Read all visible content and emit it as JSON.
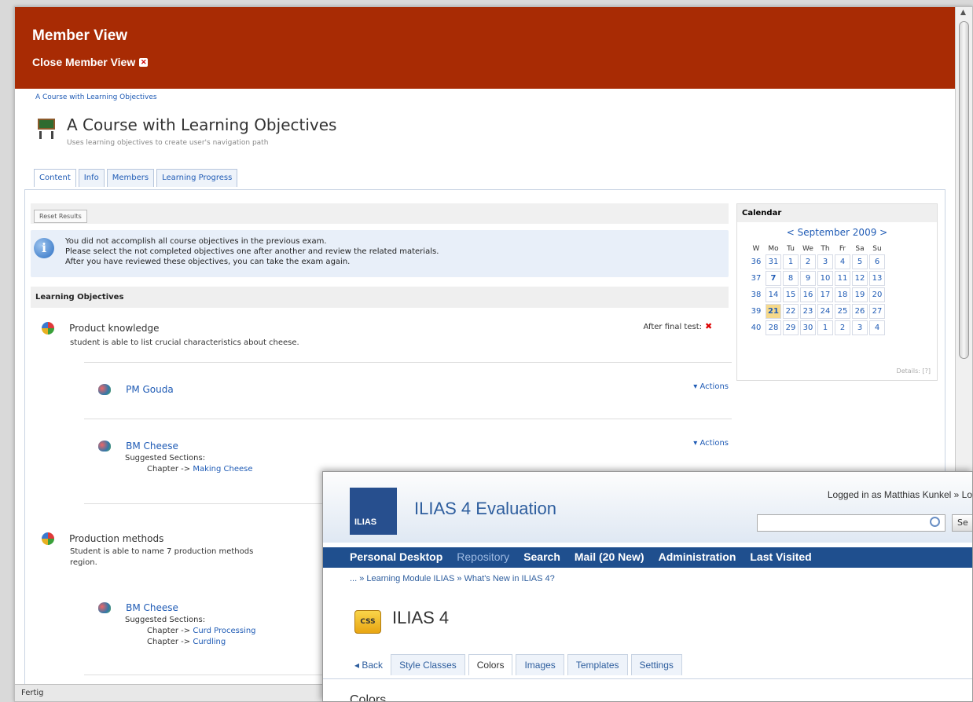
{
  "member_view": {
    "title": "Member View",
    "close_label": "Close Member View"
  },
  "breadcrumb": "A Course with Learning Objectives",
  "course": {
    "title": "A Course with Learning Objectives",
    "description": "Uses learning objectives to create user's navigation path"
  },
  "tabs": [
    "Content",
    "Info",
    "Members",
    "Learning Progress"
  ],
  "reset_button": "Reset Results",
  "info_message": [
    "You did not accomplish all course objectives in the previous exam.",
    "Please select the not completed objectives one after another and review the related materials.",
    "After you have reviewed these objectives, you can take the exam again."
  ],
  "objectives_header": "Learning Objectives",
  "objectives": [
    {
      "title": "Product knowledge",
      "description": "student is able to list crucial characteristics about cheese.",
      "after_test": "After final test:",
      "items": [
        {
          "title": "PM Gouda",
          "actions": "Actions"
        },
        {
          "title": "BM Cheese",
          "actions": "Actions",
          "suggested": "Suggested Sections:",
          "chapter_prefix": "Chapter ->",
          "chapters": [
            "Making Cheese"
          ]
        }
      ]
    },
    {
      "title": "Production methods",
      "description": "Student is able to name 7 production methods",
      "description2": "region.",
      "items": [
        {
          "title": "BM Cheese",
          "suggested": "Suggested Sections:",
          "chapter_prefix": "Chapter ->",
          "chapters": [
            "Curd Processing",
            "Curdling"
          ]
        }
      ]
    }
  ],
  "calendar": {
    "header": "Calendar",
    "month": "< September 2009 >",
    "weekday_header": [
      "W",
      "Mo",
      "Tu",
      "We",
      "Th",
      "Fr",
      "Sa",
      "Su"
    ],
    "weeks": [
      [
        "36",
        "31",
        "1",
        "2",
        "3",
        "4",
        "5",
        "6"
      ],
      [
        "37",
        "7",
        "8",
        "9",
        "10",
        "11",
        "12",
        "13"
      ],
      [
        "38",
        "14",
        "15",
        "16",
        "17",
        "18",
        "19",
        "20"
      ],
      [
        "39",
        "21",
        "22",
        "23",
        "24",
        "25",
        "26",
        "27"
      ],
      [
        "40",
        "28",
        "29",
        "30",
        "1",
        "2",
        "3",
        "4"
      ]
    ],
    "today": "21",
    "details": "Details: [?]"
  },
  "status_bar": "Fertig",
  "ilias": {
    "logo_text": "ILIAS",
    "installation": "ILIAS 4 Evaluation",
    "login_info": "Logged in as Matthias Kunkel » Lo",
    "search_button": "Se",
    "main_menu": [
      "Personal Desktop",
      "Repository",
      "Search",
      "Mail (20 New)",
      "Administration",
      "Last Visited"
    ],
    "active_menu": "Repository",
    "breadcrumb": "... » Learning Module ILIAS » What's New in ILIAS 4?",
    "item_icon": "CSS",
    "item_title": "ILIAS 4",
    "back": "Back",
    "tabs": [
      "Style Classes",
      "Colors",
      "Images",
      "Templates",
      "Settings"
    ],
    "active_tab": "Colors",
    "heading": "Colors"
  }
}
